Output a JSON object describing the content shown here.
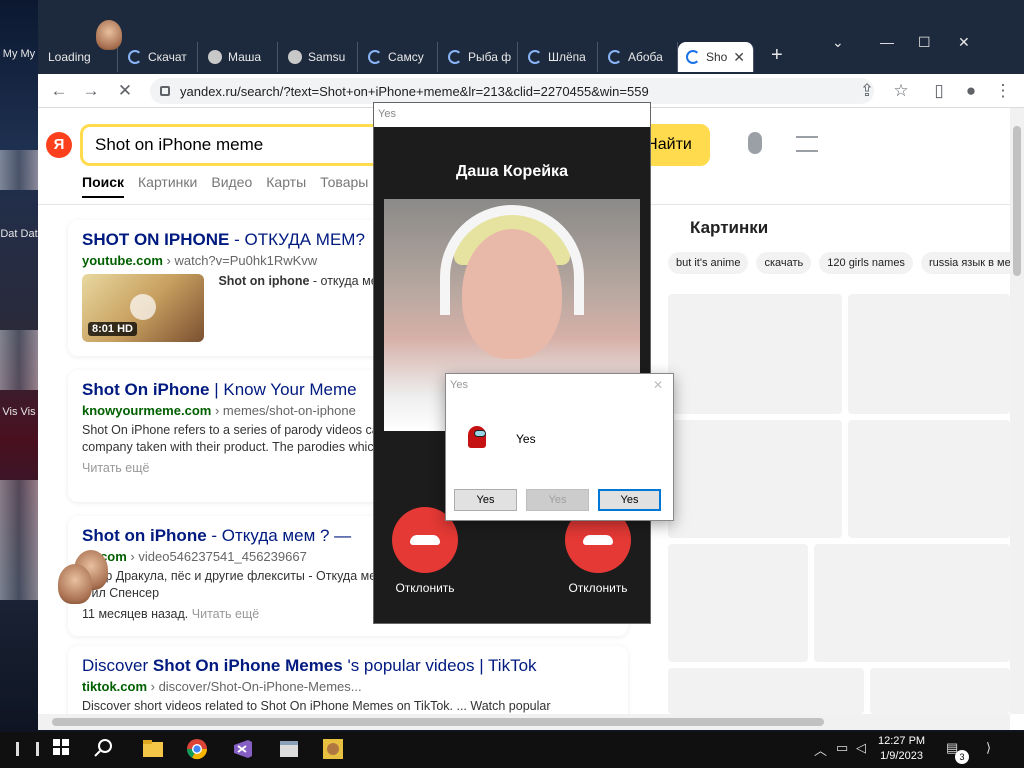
{
  "desktop": {
    "icons": [
      {
        "label": "My My"
      },
      {
        "label": "Dat Dat"
      },
      {
        "label": "Vis Vis"
      }
    ]
  },
  "browser": {
    "tabs": [
      {
        "label": "Loading"
      },
      {
        "label": "Скачат"
      },
      {
        "label": "Маша"
      },
      {
        "label": "Samsu"
      },
      {
        "label": "Самсу"
      },
      {
        "label": "Рыба ф"
      },
      {
        "label": "Шлёпа"
      },
      {
        "label": "Абоба"
      },
      {
        "label": "Sho"
      }
    ],
    "new_tab_label": "+",
    "url": "yandex.ru/search/?text=Shot+on+iPhone+meme&lr=213&clid=2270455&win=559"
  },
  "search": {
    "logo": "Я",
    "query": "Shot on iPhone meme",
    "submit_label": "Найти",
    "nav_tabs": [
      "Поиск",
      "Картинки",
      "Видео",
      "Карты",
      "Товары"
    ]
  },
  "results": [
    {
      "title_bold": "SHOT ON IPHONE",
      "title_rest": " - ОТКУДА МЕМ?",
      "domain": "youtube.com",
      "path": " › watch?v=Pu0hk1RwKvw",
      "duration": "8:01 HD",
      "snippet_bold": "Shot on iphone",
      "snippet": " - откуда мем"
    },
    {
      "title_bold": "Shot On iPhone",
      "title_rest": " | Know Your Meme",
      "domain": "knowyourmeme.com",
      "path": " › memes/shot-on-iphone",
      "snippet": "Shot On iPhone refers to a series of parody videos campaign \"Shot on iPhone\" in which the company taken with their product. The parodies which began",
      "more": "Читать ещё"
    },
    {
      "title_bold": "Shot on iPhone",
      "title_rest": " - Откуда мем ? —",
      "domain": "vk.com",
      "path": " › video546237541_456239667",
      "snippet": "Граф Дракула, пёс и другие флекситы - Откуда мем месяцев назад. Видео удалено. ... Фил Спенсер",
      "age": "11 месяцев назад.",
      "more": "Читать ещё"
    },
    {
      "title_prefix": "Discover ",
      "title_bold": "Shot On iPhone Memes",
      "title_rest": " 's popular videos | TikTok",
      "domain": "tiktok.com",
      "path": " › discover/Shot-On-iPhone-Memes...",
      "snippet": "Discover short videos related to Shot On iPhone Memes on TikTok. ... Watch popular"
    }
  ],
  "images_panel": {
    "title": "Картинки",
    "chips": [
      "but it's anime",
      "скачать",
      "120 girls names",
      "russia язык в ме"
    ]
  },
  "call_window": {
    "title": "Yes",
    "caller": "Даша Корейка",
    "decline_left": "Отклонить",
    "decline_right": "Отклонить"
  },
  "dialog": {
    "title": "Yes",
    "message": "Yes",
    "buttons": [
      "Yes",
      "Yes",
      "Yes"
    ]
  },
  "taskbar": {
    "time": "12:27 PM",
    "date": "1/9/2023",
    "notifications": "3"
  },
  "colors": {
    "yandex_red": "#fc3f1d",
    "search_yellow": "#ffdb4d",
    "link_blue": "#001a80",
    "url_green": "#006000",
    "decline_red": "#e53935"
  }
}
